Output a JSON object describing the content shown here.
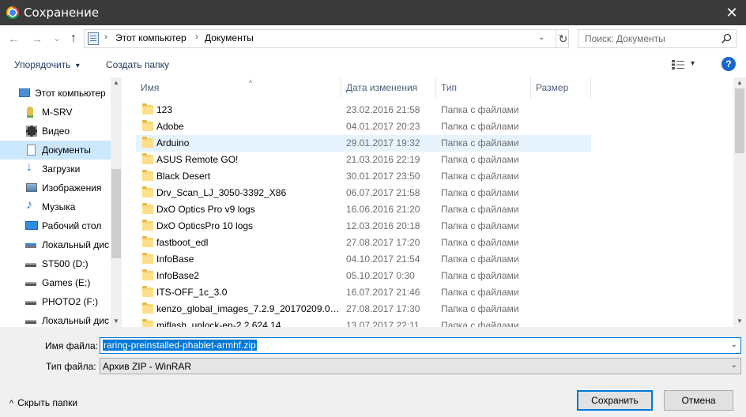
{
  "window": {
    "title": "Сохранение",
    "close_glyph": "✕"
  },
  "nav_buttons": {
    "back": "←",
    "forward": "→",
    "recent": "⌄",
    "up": "↑"
  },
  "address": {
    "crumbs": [
      "Этот компьютер",
      "Документы"
    ],
    "separator": "›",
    "dropdown": "⌄",
    "refresh": "↻"
  },
  "search": {
    "placeholder": "Поиск: Документы"
  },
  "toolbar": {
    "organize_label": "Упорядочить",
    "organize_arrow": "▾",
    "new_folder_label": "Создать папку",
    "view_arrow": "▾",
    "help": "?"
  },
  "navigation": {
    "items": [
      {
        "label": "Этот компьютер",
        "icon": "computer-icon"
      },
      {
        "label": "M-SRV",
        "icon": "network-user-icon"
      },
      {
        "label": "Видео",
        "icon": "video-icon"
      },
      {
        "label": "Документы",
        "icon": "documents-icon",
        "selected": true
      },
      {
        "label": "Загрузки",
        "icon": "downloads-icon"
      },
      {
        "label": "Изображения",
        "icon": "pictures-icon"
      },
      {
        "label": "Музыка",
        "icon": "music-icon"
      },
      {
        "label": "Рабочий стол",
        "icon": "desktop-icon"
      },
      {
        "label": "Локальный дис",
        "icon": "drive-icon"
      },
      {
        "label": "ST500 (D:)",
        "icon": "drive-icon"
      },
      {
        "label": "Games (E:)",
        "icon": "drive-icon"
      },
      {
        "label": "PHOTO2 (F:)",
        "icon": "drive-icon"
      },
      {
        "label": "Локальный дис",
        "icon": "drive-icon"
      }
    ]
  },
  "columns": {
    "name": "Имя",
    "date": "Дата изменения",
    "type": "Тип",
    "size": "Размер",
    "sort_glyph": "^"
  },
  "files": [
    {
      "name": "123",
      "date": "23.02.2016 21:58",
      "type": "Папка с файлами"
    },
    {
      "name": "Adobe",
      "date": "04.01.2017 20:23",
      "type": "Папка с файлами"
    },
    {
      "name": "Arduino",
      "date": "29.01.2017 19:32",
      "type": "Папка с файлами",
      "hover": true
    },
    {
      "name": "ASUS Remote GO!",
      "date": "21.03.2016 22:19",
      "type": "Папка с файлами"
    },
    {
      "name": "Black Desert",
      "date": "30.01.2017 23:50",
      "type": "Папка с файлами"
    },
    {
      "name": "Drv_Scan_LJ_3050-3392_X86",
      "date": "06.07.2017 21:58",
      "type": "Папка с файлами"
    },
    {
      "name": "DxO Optics Pro v9 logs",
      "date": "16.06.2016 21:20",
      "type": "Папка с файлами"
    },
    {
      "name": "DxO OpticsPro 10 logs",
      "date": "12.03.2016 20:18",
      "type": "Папка с файлами"
    },
    {
      "name": "fastboot_edl",
      "date": "27.08.2017 17:20",
      "type": "Папка с файлами"
    },
    {
      "name": "InfoBase",
      "date": "04.10.2017 21:54",
      "type": "Папка с файлами"
    },
    {
      "name": "InfoBase2",
      "date": "05.10.2017 0:30",
      "type": "Папка с файлами"
    },
    {
      "name": "ITS-OFF_1c_3.0",
      "date": "16.07.2017 21:46",
      "type": "Папка с файлами"
    },
    {
      "name": "kenzo_global_images_7.2.9_20170209.000...",
      "date": "27.08.2017 17:30",
      "type": "Папка с файлами"
    },
    {
      "name": "miflash_unlock-en-2.2.624.14",
      "date": "13.07.2017 22:11",
      "type": "Папка с файлами"
    }
  ],
  "form": {
    "filename_label": "Имя файла:",
    "filename_value": "raring-preinstalled-phablet-armhf.zip",
    "filetype_label": "Тип файла:",
    "filetype_value": "Архив ZIP - WinRAR",
    "dd_glyph": "⌄"
  },
  "footer": {
    "hide_folders_label": "Скрыть папки",
    "hide_glyph": "^",
    "save_label": "Сохранить",
    "cancel_label": "Отмена"
  },
  "scroll": {
    "up": "▲",
    "down": "▼"
  }
}
